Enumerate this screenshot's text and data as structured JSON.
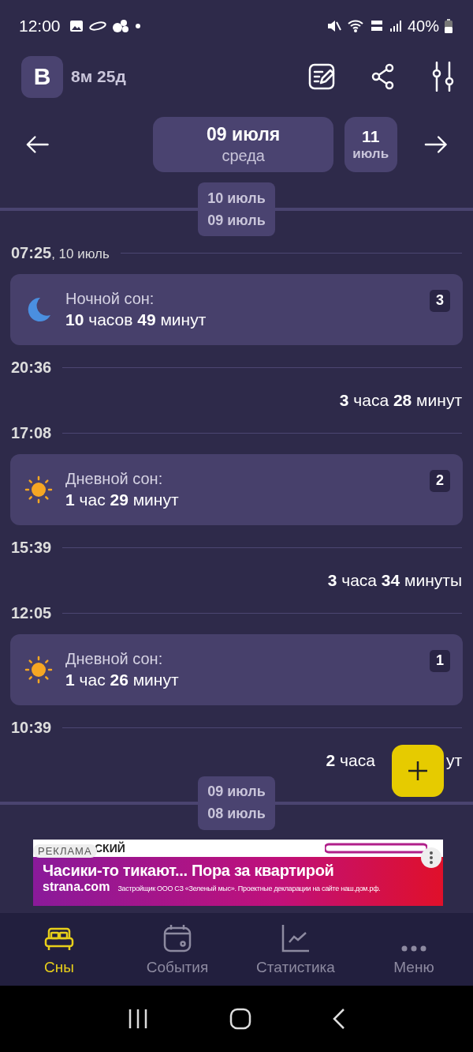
{
  "status_bar": {
    "time": "12:00",
    "battery": "40%"
  },
  "header": {
    "avatar_letter": "B",
    "age": "8м 25д"
  },
  "date_nav": {
    "current_date": "09 июля",
    "current_weekday": "среда",
    "next_day": "11",
    "next_month": "июль"
  },
  "timeline": [
    {
      "kind": "divider",
      "top": "10 июль",
      "bottom": "09 июль"
    },
    {
      "kind": "time",
      "time": "07:25",
      "suffix": ", 10 июль"
    },
    {
      "kind": "night_sleep",
      "title": "Ночной сон:",
      "duration": "**10** часов **49** минут",
      "badge": "3"
    },
    {
      "kind": "time",
      "time": "20:36"
    },
    {
      "kind": "gap",
      "duration": "**3** часа **28** минут"
    },
    {
      "kind": "time",
      "time": "17:08"
    },
    {
      "kind": "day_sleep",
      "title": "Дневной сон:",
      "duration": "**1** час **29** минут",
      "badge": "2"
    },
    {
      "kind": "time",
      "time": "15:39"
    },
    {
      "kind": "gap",
      "duration": "**3** часа **34** минуты"
    },
    {
      "kind": "time",
      "time": "12:05"
    },
    {
      "kind": "day_sleep",
      "title": "Дневной сон:",
      "duration": "**1** час **26** минут",
      "badge": "1"
    },
    {
      "kind": "time",
      "time": "10:39"
    },
    {
      "kind": "gap",
      "duration": "**2** часа",
      "tail": "ут"
    },
    {
      "kind": "divider",
      "top": "09 июль",
      "bottom": "08 июль"
    }
  ],
  "ad": {
    "label": "РЕКЛАМА",
    "top_text": "СКИЙ",
    "headline": "Часики-то тикают... Пора за квартирой",
    "site": "strana.com",
    "disclaimer": "Застройщик ООО СЗ «Зеленый мыс». Проектные декларации на сайте наш.дом.рф."
  },
  "tabs": [
    {
      "label": "Сны",
      "selected": true
    },
    {
      "label": "События",
      "selected": false
    },
    {
      "label": "Статистика",
      "selected": false
    },
    {
      "label": "Меню",
      "selected": false
    }
  ]
}
